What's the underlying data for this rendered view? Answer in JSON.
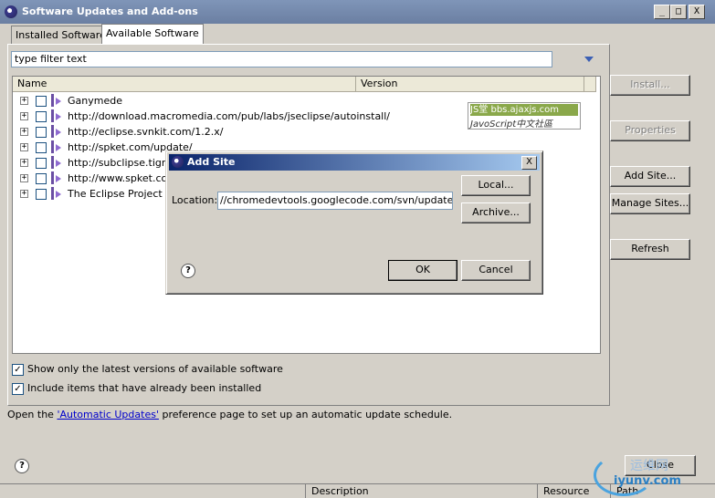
{
  "window": {
    "title": "Software Updates and Add-ons",
    "minimize_label": "_",
    "maximize_label": "□",
    "close_label": "X"
  },
  "tabs": [
    {
      "label": "Installed Software",
      "active": false
    },
    {
      "label": "Available Software",
      "active": true
    }
  ],
  "filter": {
    "value": "type filter text"
  },
  "tree": {
    "columns": [
      "Name",
      "Version"
    ],
    "rows": [
      {
        "label": "Ganymede"
      },
      {
        "label": "http://download.macromedia.com/pub/labs/jseclipse/autoinstall/"
      },
      {
        "label": "http://eclipse.svnkit.com/1.2.x/"
      },
      {
        "label": "http://spket.com/update/"
      },
      {
        "label": "http://subclipse.tigris.org/"
      },
      {
        "label": "http://www.spket.com"
      },
      {
        "label": "The Eclipse Project Updates"
      }
    ]
  },
  "side_buttons": {
    "install": "Install...",
    "properties": "Properties",
    "add_site": "Add Site...",
    "manage_sites": "Manage Sites...",
    "refresh": "Refresh"
  },
  "options": {
    "latest_only": {
      "label": "Show only the latest versions of available software",
      "checked": true
    },
    "include_installed": {
      "label": "Include items that have already been installed",
      "checked": true
    }
  },
  "footer": {
    "prefix": "Open the ",
    "link": "'Automatic Updates'",
    "suffix": " preference page to set up an automatic update schedule.",
    "close_label": "Close"
  },
  "bottom_strip": {
    "description": "Description",
    "resource": "Resource",
    "path": "Path"
  },
  "dialog": {
    "title": "Add Site",
    "location_label": "Location:",
    "location_value": "//chromedevtools.googlecode.com/svn/update/dev/",
    "local_button": "Local...",
    "archive_button": "Archive...",
    "ok_button": "OK",
    "cancel_button": "Cancel",
    "close_label": "X",
    "help_glyph": "?"
  },
  "watermarks": {
    "js_top": "JS堂 bbs.ajaxjs.com",
    "js_bottom": "JavoScript中文社區",
    "iyunv": "iyunv.com",
    "iyunv_cn": "运维网"
  },
  "help_glyph": "?",
  "check_glyph": "✓",
  "colors": {
    "dialog_title_start": "#0a246a",
    "dialog_title_end": "#a6caf0",
    "link": "#0000cc"
  }
}
